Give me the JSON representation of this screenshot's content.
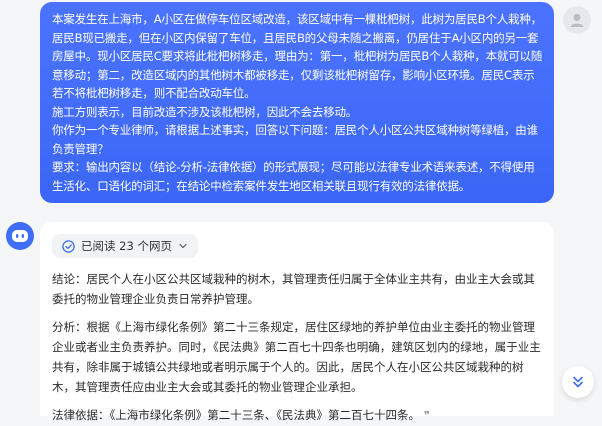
{
  "user_message": {
    "paragraph_1": "本案发生在上海市，A小区在做停车位区域改造，该区域中有一棵枇杷树，此树为居民B个人栽种，居民B现已搬走，但在小区内保留了车位，且居民B的父母未随之搬离，仍居住于A小区内的另一套房屋中。现小区居民C要求将此枇杷树移走，理由为：第一，枇杷树为居民B个人栽种，本就可以随意移动；第二，改造区域内的其他树木都被移走，仅剩该枇杷树留存，影响小区环境。居民C表示若不将枇杷树移走，则不配合改动车位。",
    "paragraph_2": "施工方则表示，目前改造不涉及该枇杷树，因此不会去移动。",
    "paragraph_3": "你作为一个专业律师，请根据上述事实，回答以下问题：居民个人小区公共区域种树等绿植，由谁负责管理？",
    "paragraph_4": "要求：输出内容以（结论-分析-法律依据）的形式展现；尽可能以法律专业术语来表述，不得使用生活化、口语化的词汇；在结论中检索案件发生地区相关联且现行有效的法律依据。"
  },
  "answer": {
    "read_pill": "已阅读 23 个网页",
    "conclusion": "结论：居民个人在小区公共区域栽种的树木，其管理责任归属于全体业主共有，由业主大会或其委托的物业管理企业负责日常养护管理。",
    "analysis": "分析：根据《上海市绿化条例》第二十三条规定，居住区绿地的养护单位由业主委托的物业管理企业或者业主负责养护。同时，《民法典》第二百七十四条也明确，建筑区划内的绿地，属于业主共有，除非属于城镇公共绿地或者明示属于个人的。因此，居民个人在小区公共区域栽种的树木，其管理责任应由业主大会或其委托的物业管理企业承担。",
    "basis": "法律依据：《上海市绿化条例》第二十三条、《民法典》第二百七十四条。",
    "quote_glyph": "❞"
  },
  "icons": {
    "user_avatar": "user-icon",
    "bot_avatar": "bot-icon",
    "read_check": "check-circle-icon",
    "read_chevron": "chevron-down-icon",
    "scroll_down": "double-chevron-down-icon"
  },
  "colors": {
    "user_bubble": "#3b66f5",
    "bot_avatar": "#3f6df5",
    "page_bg": "#f5f6f8"
  }
}
